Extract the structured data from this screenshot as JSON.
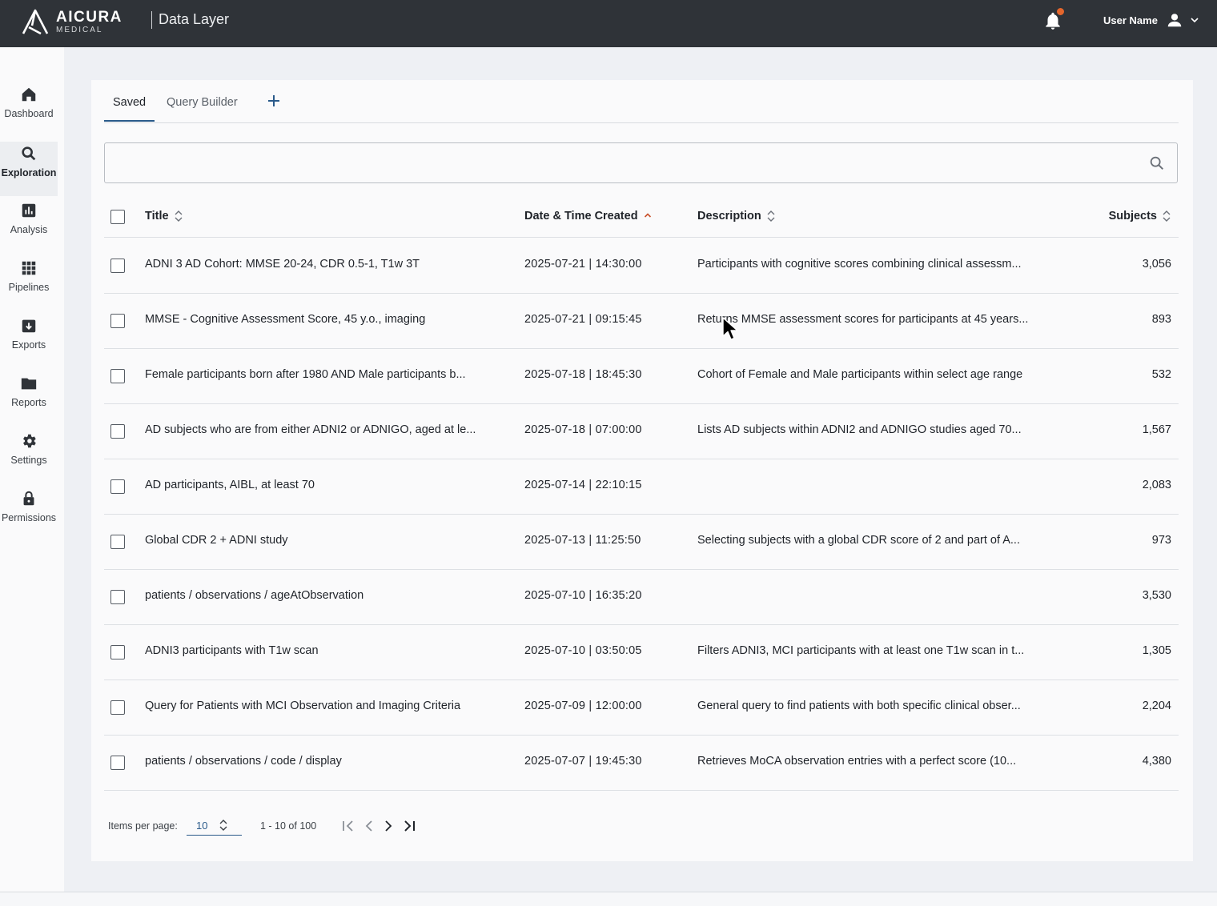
{
  "header": {
    "brand_name": "AICURA",
    "brand_sub": "MEDICAL",
    "app_title": "Data Layer",
    "user_name": "User Name",
    "notification_dot_color": "#e4662c"
  },
  "sidebar": {
    "items": [
      {
        "label": "Dashboard",
        "icon": "home-icon"
      },
      {
        "label": "Exploration",
        "icon": "search-icon",
        "active": true
      },
      {
        "label": "Analysis",
        "icon": "bar-chart-icon"
      },
      {
        "label": "Pipelines",
        "icon": "grid-icon"
      },
      {
        "label": "Exports",
        "icon": "download-icon"
      },
      {
        "label": "Reports",
        "icon": "folder-icon"
      },
      {
        "label": "Settings",
        "icon": "gear-icon"
      },
      {
        "label": "Permissions",
        "icon": "lock-icon"
      }
    ]
  },
  "tabs": {
    "saved": "Saved",
    "query_builder": "Query Builder",
    "active": "Saved"
  },
  "search": {
    "value": "",
    "placeholder": ""
  },
  "table": {
    "columns": {
      "title": "Title",
      "date": "Date & Time Created",
      "description": "Description",
      "subjects": "Subjects"
    },
    "sort": {
      "column": "Date & Time Created",
      "direction": "ascending"
    },
    "rows": [
      {
        "title": "ADNI 3 AD Cohort: MMSE 20-24, CDR 0.5-1, T1w 3T",
        "date": "2025-07-21 | 14:30:00",
        "description": "Participants with cognitive scores combining clinical assessm...",
        "subjects": "3,056"
      },
      {
        "title": "MMSE - Cognitive Assessment Score, 45 y.o., imaging",
        "date": "2025-07-21 | 09:15:45",
        "description": "Returns MMSE assessment scores for participants at 45 years...",
        "subjects": "893"
      },
      {
        "title": "Female participants born after 1980 AND Male participants b...",
        "date": "2025-07-18 | 18:45:30",
        "description": "Cohort of Female and Male participants within select age range",
        "subjects": "532"
      },
      {
        "title": "AD subjects who are from either ADNI2 or ADNIGO, aged at le...",
        "date": "2025-07-18 | 07:00:00",
        "description": "Lists AD subjects within ADNI2 and ADNIGO studies aged 70...",
        "subjects": "1,567"
      },
      {
        "title": "AD participants, AIBL, at least 70",
        "date": "2025-07-14 | 22:10:15",
        "description": "",
        "subjects": "2,083"
      },
      {
        "title": "Global CDR 2 + ADNI study",
        "date": "2025-07-13 | 11:25:50",
        "description": "Selecting subjects with a global CDR score of 2 and part of A...",
        "subjects": "973"
      },
      {
        "title": "patients / observations / ageAtObservation",
        "date": "2025-07-10 | 16:35:20",
        "description": "",
        "subjects": "3,530"
      },
      {
        "title": "ADNI3 participants with T1w scan",
        "date": "2025-07-10 | 03:50:05",
        "description": "Filters ADNI3, MCI participants with at least one T1w scan in t...",
        "subjects": "1,305"
      },
      {
        "title": "Query for Patients with MCI Observation and Imaging Criteria",
        "date": "2025-07-09 | 12:00:00",
        "description": "General query to find patients with both specific clinical obser...",
        "subjects": "2,204"
      },
      {
        "title": "patients / observations / code / display",
        "date": "2025-07-07 | 19:45:30",
        "description": "Retrieves MoCA observation entries with a perfect score (10...",
        "subjects": "4,380"
      }
    ]
  },
  "pagination": {
    "items_per_page_label": "Items per page:",
    "items_per_page": "10",
    "range": "1 - 10 of 100"
  },
  "colors": {
    "topbar": "#2f3338",
    "accent": "#2a5a8a",
    "sort_active": "#c8502a"
  }
}
